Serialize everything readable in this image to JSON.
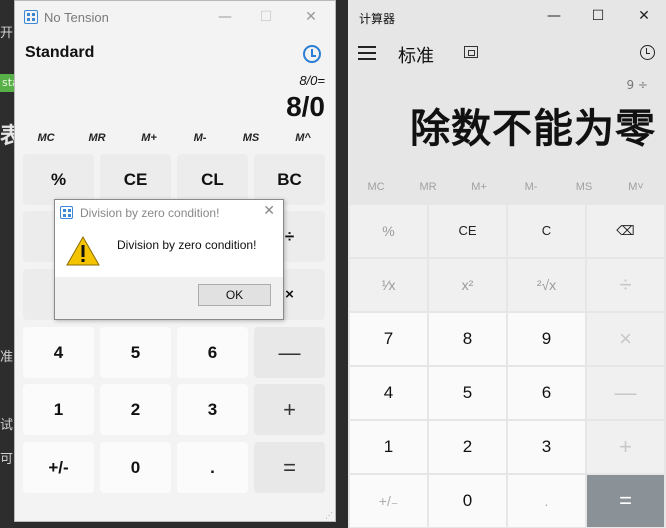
{
  "background": {
    "chars": [
      "开",
      "准",
      "试",
      "可"
    ],
    "tag": "standard",
    "big_char": "表"
  },
  "left_calc": {
    "title": "No Tension",
    "mode": "Standard",
    "expression": "8/0=",
    "display": "8/0",
    "memory": [
      "MC",
      "MR",
      "M+",
      "M-",
      "MS",
      "M^"
    ],
    "keys": [
      "%",
      "CE",
      "CL",
      "BC",
      "1",
      "÷",
      "×",
      "4",
      "5",
      "6",
      "—",
      "1",
      "2",
      "3",
      "+",
      "+/-",
      "0",
      ".",
      "="
    ]
  },
  "dialog": {
    "title": "Division by zero condition!",
    "message": "Division by zero condition!",
    "ok_label": "OK"
  },
  "right_calc": {
    "title": "计算器",
    "mode": "标准",
    "expression": "9 ÷",
    "display": "除数不能为零",
    "memory": [
      "MC",
      "MR",
      "M+",
      "M-",
      "MS",
      "M˅"
    ],
    "keys": [
      "%",
      "CE",
      "C",
      "⌫",
      "¹⁄x",
      "x²",
      "²√x",
      "÷",
      "7",
      "8",
      "9",
      "×",
      "4",
      "5",
      "6",
      "—",
      "1",
      "2",
      "3",
      "+",
      "+/₋",
      "0",
      ".",
      "="
    ]
  },
  "colors": {
    "accent": "#2a7fd4",
    "equals": "#8a9197",
    "warning": "#f5c400"
  }
}
